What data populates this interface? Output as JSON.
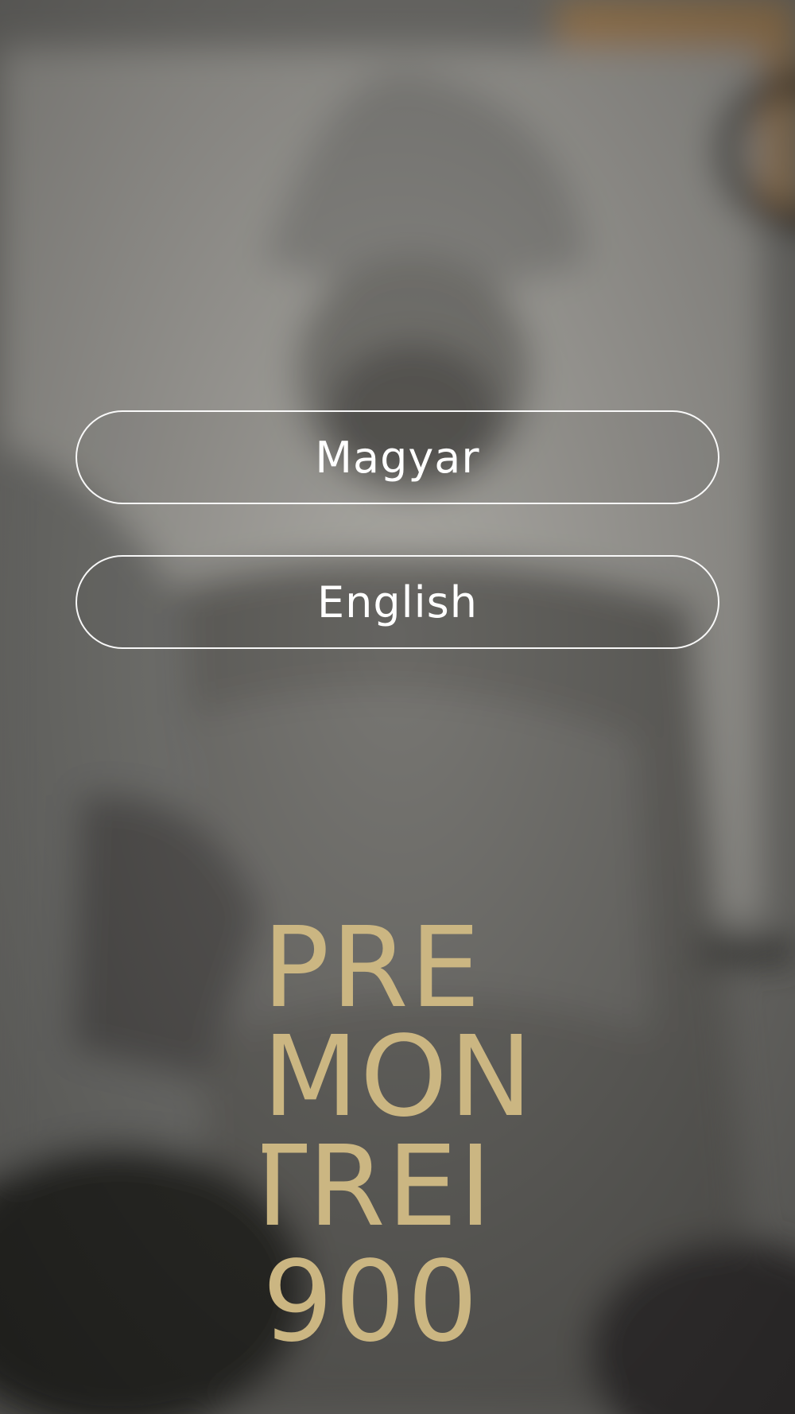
{
  "language_select": {
    "magyar_label": "Magyar",
    "english_label": "English"
  },
  "logo": {
    "line1": "PRE",
    "line2": "MON",
    "line3": "TREI",
    "line4": "900",
    "color": "#cbb682"
  },
  "background": {
    "description_icon": "statue-photo-background"
  }
}
